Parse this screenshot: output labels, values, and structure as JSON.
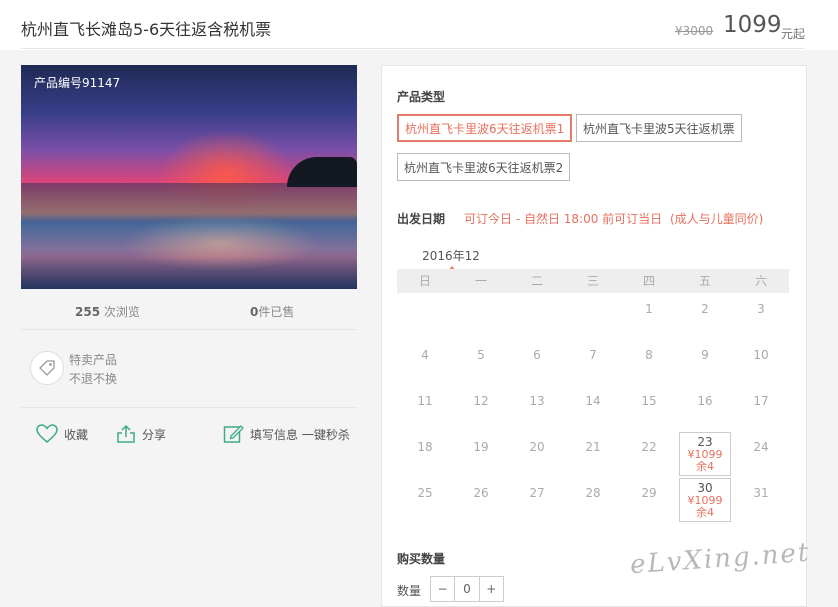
{
  "header": {
    "title": "杭州直飞长滩岛5-6天往返含税机票",
    "original_price": "¥3000",
    "price": "1099",
    "price_unit": "元起"
  },
  "product": {
    "code_label": "产品编号91147",
    "views_count": "255",
    "views_label": "次浏览",
    "sold_count": "0",
    "sold_label": "件已售",
    "special_line1": "特卖产品",
    "special_line2": "不退不换",
    "actions": {
      "favorite": "收藏",
      "share": "分享",
      "fill_info": "填写信息 一键秒杀"
    }
  },
  "booking": {
    "product_type_label": "产品类型",
    "types": [
      "杭州直飞卡里波6天往返机票1",
      "杭州直飞卡里波5天往返机票",
      "杭州直飞卡里波6天往返机票2"
    ],
    "selected_type_index": 0,
    "departure_label": "出发日期",
    "departure_note": "可订今日 - 自然日 18:00 前可订当日",
    "price_note": "(成人与儿童同价)",
    "month": "2016年12",
    "weekdays": [
      "日",
      "一",
      "二",
      "三",
      "四",
      "五",
      "六"
    ],
    "dates": [
      [
        "",
        "",
        "",
        "",
        "1",
        "2",
        "3"
      ],
      [
        "4",
        "5",
        "6",
        "7",
        "8",
        "9",
        "10"
      ],
      [
        "11",
        "12",
        "13",
        "14",
        "15",
        "16",
        "17"
      ],
      [
        "18",
        "19",
        "20",
        "21",
        "22",
        "23",
        "24"
      ],
      [
        "25",
        "26",
        "27",
        "28",
        "29",
        "30",
        "31"
      ]
    ],
    "available": [
      {
        "date": "23",
        "price": "¥1099",
        "stock": "余4"
      },
      {
        "date": "30",
        "price": "¥1099",
        "stock": "余4"
      }
    ],
    "quantity_section_label": "购买数量",
    "quantity_label": "数量",
    "quantity_value": "0",
    "quantity_minus": "−",
    "quantity_plus": "+"
  },
  "watermark": "eLvXing.net",
  "colors": {
    "accent": "#e8705e",
    "icon_green": "#3daa8a"
  }
}
